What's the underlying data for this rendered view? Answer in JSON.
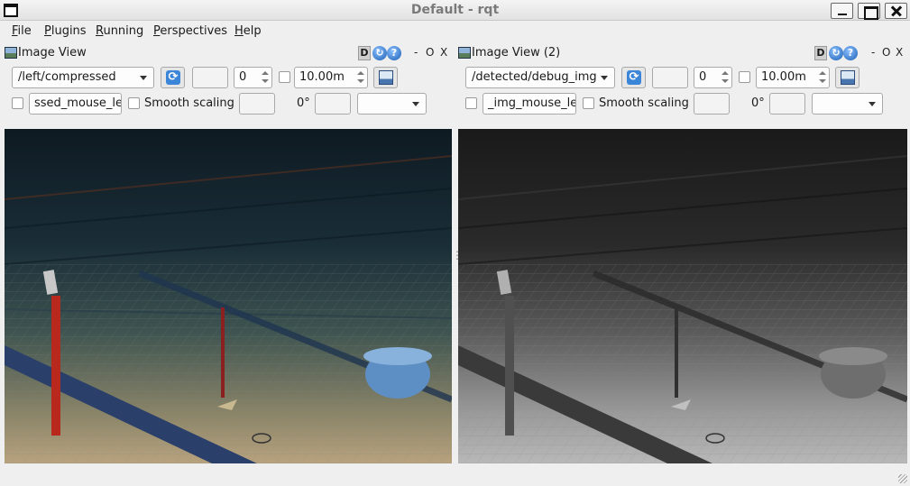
{
  "window": {
    "title": "Default - rqt",
    "buttons": [
      "minimize",
      "maximize",
      "close"
    ]
  },
  "menubar": {
    "items": [
      {
        "mnemonic": "F",
        "rest": "ile"
      },
      {
        "mnemonic": "P",
        "rest": "lugins"
      },
      {
        "mnemonic": "R",
        "rest": "unning"
      },
      {
        "mnemonic": "P",
        "rest": "erspectives"
      },
      {
        "mnemonic": "H",
        "rest": "elp"
      }
    ]
  },
  "panels": [
    {
      "title": "Image View",
      "header_buttons": {
        "d": "D",
        "minimize": "-",
        "float": "O",
        "close": "X"
      },
      "topic": "/left/compressed",
      "number_value": "0",
      "timeout_value": "10.00m",
      "mouse_topic": "ssed_mouse_left",
      "smooth_scaling_label": "Smooth scaling",
      "rotation_label": "0°",
      "image": {
        "type": "color",
        "description": "underwater pool camera view"
      }
    },
    {
      "title": "Image View (2)",
      "header_buttons": {
        "d": "D",
        "minimize": "-",
        "float": "O",
        "close": "X"
      },
      "topic": "/detected/debug_img",
      "number_value": "0",
      "timeout_value": "10.00m",
      "mouse_topic": "_img_mouse_left",
      "smooth_scaling_label": "Smooth scaling",
      "rotation_label": "0°",
      "image": {
        "type": "grayscale",
        "description": "debug grayscale view"
      }
    }
  ],
  "colors": {
    "window_bg": "#efefef",
    "title_text": "#7a7a7a",
    "refresh_blue": "#3b86d9"
  }
}
